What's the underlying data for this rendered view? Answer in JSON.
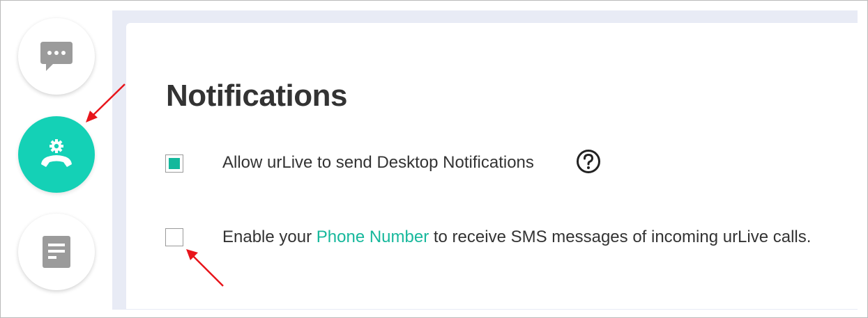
{
  "sidebar": {
    "items": [
      {
        "icon": "chat-bubble-icon",
        "active": false
      },
      {
        "icon": "phone-settings-icon",
        "active": true
      },
      {
        "icon": "document-icon",
        "active": false
      }
    ]
  },
  "main": {
    "title": "Notifications",
    "options": [
      {
        "checked": true,
        "text": "Allow urLive to send Desktop Notifications",
        "help_icon": "question-circle-icon"
      },
      {
        "checked": false,
        "text_before": "Enable your ",
        "link_text": "Phone Number",
        "text_after": " to receive SMS messages of incoming urLive calls."
      }
    ]
  },
  "colors": {
    "accent": "#14d1b6",
    "checkbox_fill": "#14b89c",
    "link": "#17b89c",
    "text": "#333333",
    "annotation_arrow": "#e8151b"
  }
}
